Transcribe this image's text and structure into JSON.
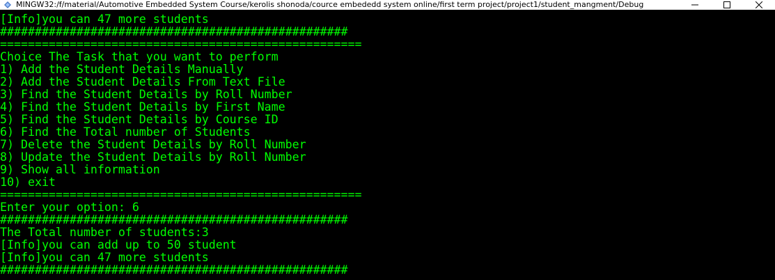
{
  "window": {
    "title": "MINGW32:/f/material/Automotive Embedded System Course/kerolis shonoda/cource embededd system online/first term project/project1/student_mangment/Debug",
    "icon": "mingw-terminal-icon",
    "controls": {
      "minimize_icon": "minimize-icon",
      "maximize_icon": "maximize-icon",
      "close_icon": "close-icon"
    }
  },
  "colors": {
    "background": "#000000",
    "text": "#00ff00",
    "titlebar": "#ffffff"
  },
  "terminal": {
    "lines": [
      "[Info]you can 47 more students",
      "##################################################",
      "====================================================",
      "Choice The Task that you want to perform",
      "1) Add the Student Details Manually",
      "2) Add the Student Details From Text File",
      "3) Find the Student Details by Roll Number",
      "4) Find the Student Details by First Name",
      "5) Find the Student Details by Course ID",
      "6) Find the Total number of Students",
      "7) Delete the Student Details by Roll Number",
      "8) Update the Student Details by Roll Number",
      "9) Show all information",
      "10) exit",
      "====================================================",
      "Enter your option: 6",
      "##################################################",
      "The Total number of students:3",
      "[Info]you can add up to 50 student",
      "[Info]you can 47 more students",
      "##################################################"
    ]
  }
}
